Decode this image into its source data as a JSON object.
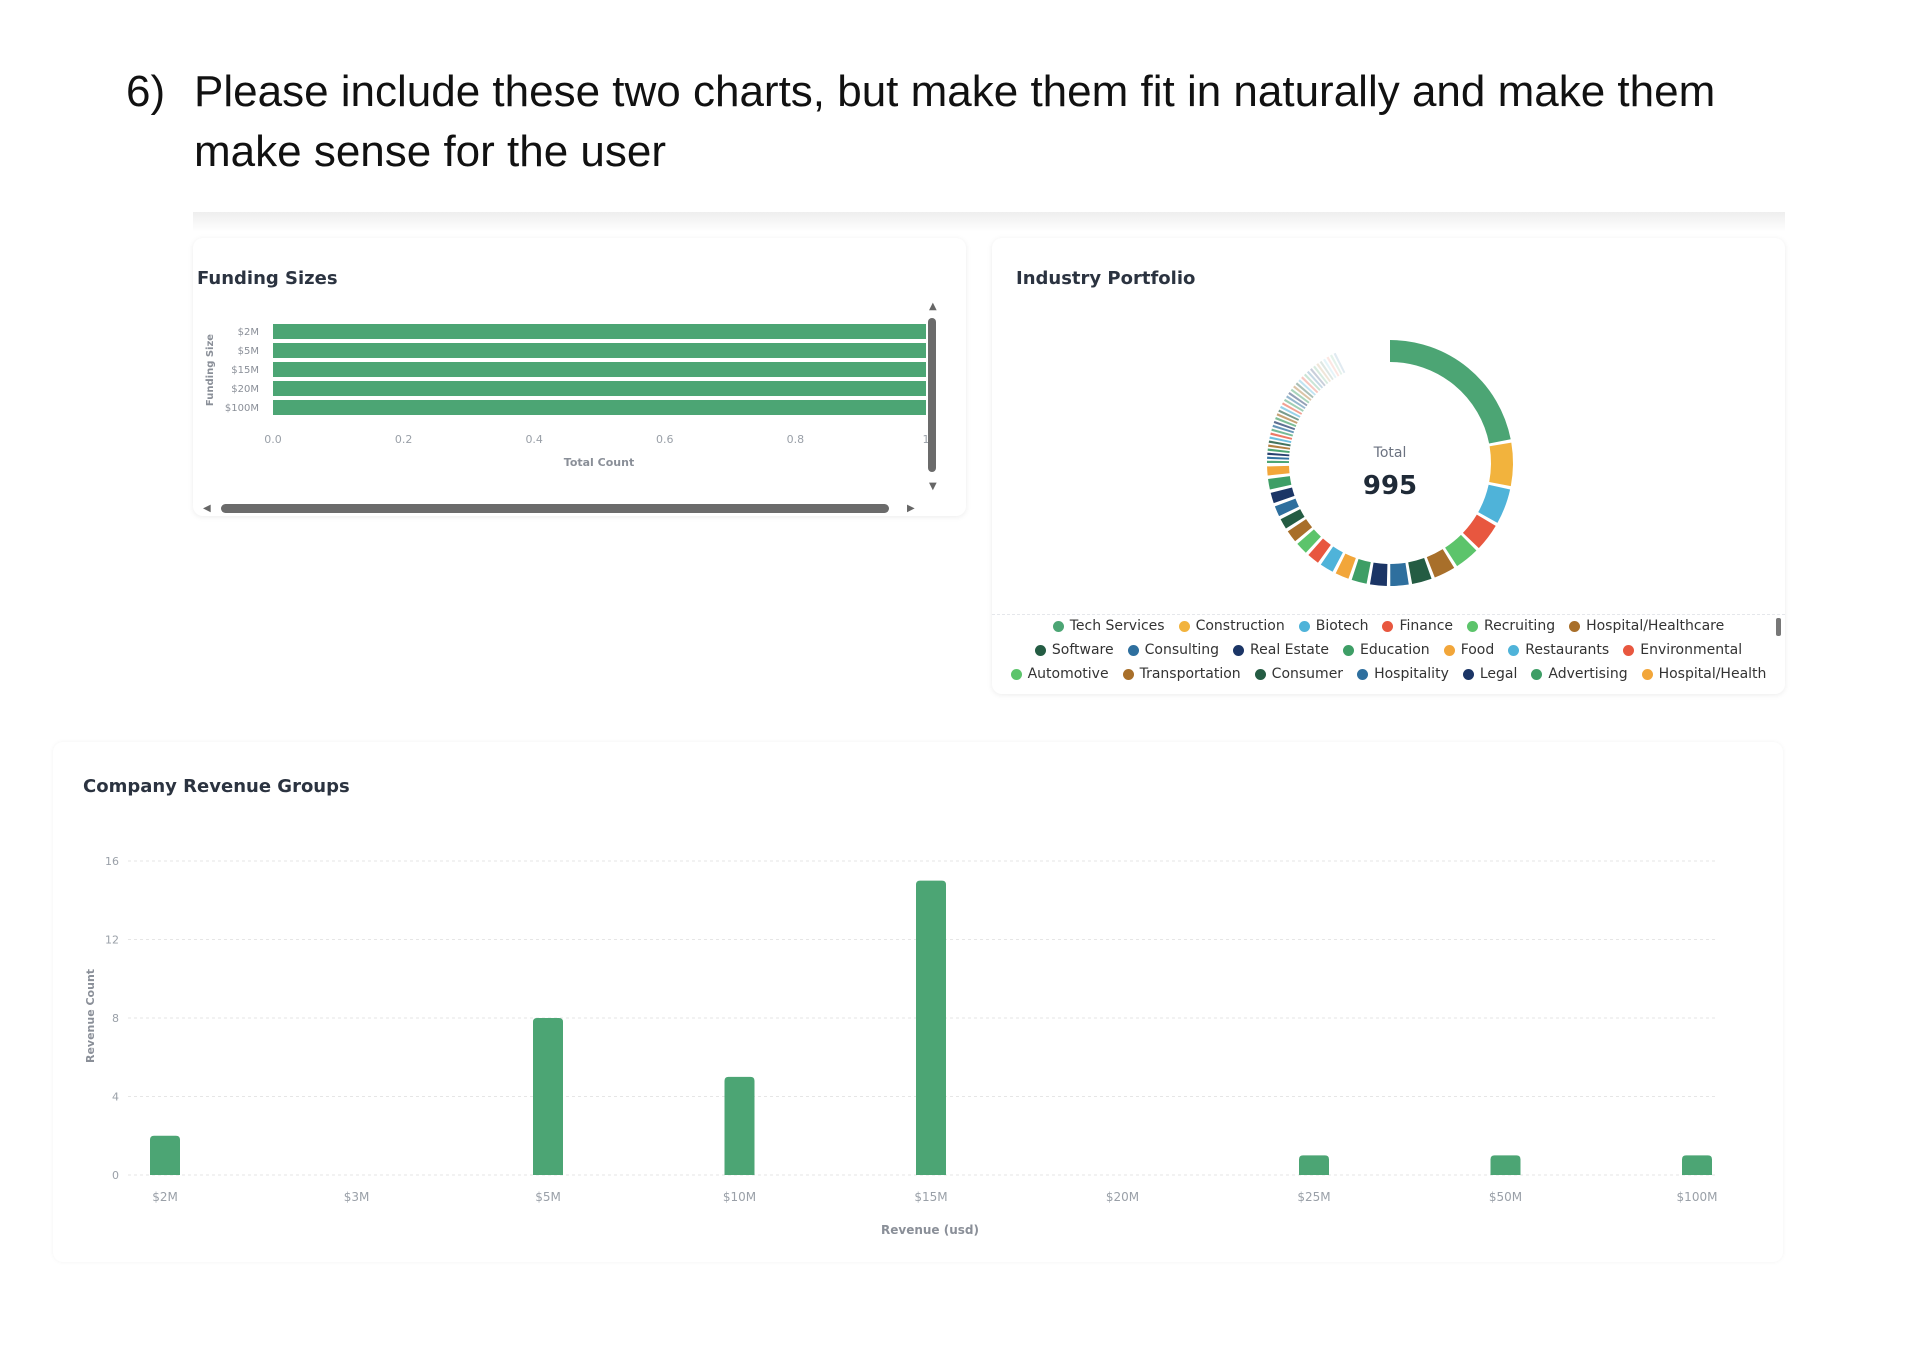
{
  "instruction": {
    "number": "6)",
    "text": "Please include these two charts, but make them fit in naturally and make them make sense for the user"
  },
  "colors": {
    "bar_green": "#4ca574",
    "grid": "#e6e6e6"
  },
  "funding_card": {
    "title": "Funding Sizes"
  },
  "industry_card": {
    "title": "Industry Portfolio",
    "center_label": "Total",
    "center_value": "995"
  },
  "revenue_card": {
    "title": "Company Revenue Groups"
  },
  "chart_data": [
    {
      "type": "bar",
      "orientation": "horizontal",
      "title": "Funding Sizes",
      "categories": [
        "$2M",
        "$5M",
        "$15M",
        "$20M",
        "$100M"
      ],
      "values": [
        1,
        1,
        1,
        1,
        1
      ],
      "xlabel": "Total Count",
      "ylabel": "Funding Size",
      "xticks": [
        "0.0",
        "0.2",
        "0.4",
        "0.6",
        "0.8",
        "1"
      ],
      "xlim": [
        0,
        1
      ],
      "color": "#4ca574"
    },
    {
      "type": "pie",
      "variant": "donut",
      "title": "Industry Portfolio",
      "total": 995,
      "legend": [
        {
          "name": "Tech Services",
          "color": "#4ca574"
        },
        {
          "name": "Construction",
          "color": "#f2b33d"
        },
        {
          "name": "Biotech",
          "color": "#4fb3d9"
        },
        {
          "name": "Finance",
          "color": "#e8573f"
        },
        {
          "name": "Recruiting",
          "color": "#5cc46b"
        },
        {
          "name": "Hospital/Healthcare",
          "color": "#a86f2a"
        },
        {
          "name": "Software",
          "color": "#245c43"
        },
        {
          "name": "Consulting",
          "color": "#2e6f9e"
        },
        {
          "name": "Real Estate",
          "color": "#1b3566"
        },
        {
          "name": "Education",
          "color": "#3e9e66"
        },
        {
          "name": "Food",
          "color": "#f2a63a"
        },
        {
          "name": "Restaurants",
          "color": "#4fb3d9"
        },
        {
          "name": "Environmental",
          "color": "#e8573f"
        },
        {
          "name": "Automotive",
          "color": "#5cc46b"
        },
        {
          "name": "Transportation",
          "color": "#a86f2a"
        },
        {
          "name": "Consumer",
          "color": "#245c43"
        },
        {
          "name": "Hospitality",
          "color": "#2e6f9e"
        },
        {
          "name": "Legal",
          "color": "#1b3566"
        },
        {
          "name": "Advertising",
          "color": "#3e9e66"
        },
        {
          "name": "Hospital/Health",
          "color": "#f2a63a"
        }
      ],
      "values": [
        110,
        30,
        25,
        20,
        18,
        16,
        15,
        14,
        13,
        12,
        11,
        11,
        10,
        10,
        10,
        9,
        9,
        9,
        9,
        8
      ]
    },
    {
      "type": "bar",
      "title": "Company Revenue Groups",
      "categories": [
        "$2M",
        "$3M",
        "$5M",
        "$10M",
        "$15M",
        "$20M",
        "$25M",
        "$50M",
        "$100M"
      ],
      "values": [
        2,
        0,
        8,
        5,
        15,
        0,
        1,
        1,
        1
      ],
      "xlabel": "Revenue (usd)",
      "ylabel": "Revenue Count",
      "yticks": [
        "0",
        "4",
        "8",
        "12",
        "16"
      ],
      "ylim": [
        0,
        16
      ],
      "color": "#4ca574"
    }
  ]
}
